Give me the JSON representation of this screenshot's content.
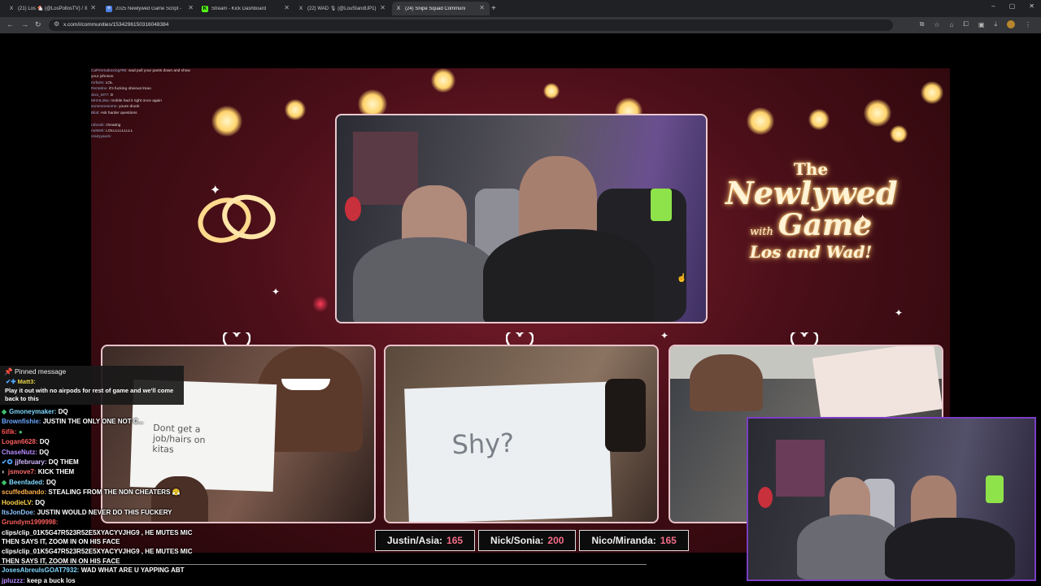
{
  "browser": {
    "tabs": [
      {
        "icon": "X",
        "title": "(21) Los 🐔 (@LosPollosTV) / X",
        "active": false
      },
      {
        "icon": "≡",
        "title": "2025 Newlywed Game Script -",
        "active": false
      },
      {
        "icon": "K",
        "title": "Stream - Kick Dashboard",
        "active": false
      },
      {
        "icon": "X",
        "title": "(22) WAD 🎙 (@LouStandUP1)",
        "active": false
      },
      {
        "icon": "X",
        "title": "(24) Snipe Squad Communi",
        "active": true
      }
    ],
    "new_tab": "+",
    "window_controls": [
      "–",
      "▢",
      "✕"
    ],
    "url": "x.com/i/communities/1534296150316048384",
    "icons": {
      "back": "←",
      "forward": "→",
      "reload": "↻",
      "tune": "⚙"
    }
  },
  "stream": {
    "title": {
      "line1": "The",
      "line2": "Newlywed",
      "with": "with",
      "game": "Game",
      "line3": "Los and Wad!"
    },
    "cards": {
      "card1": "Dont get a job/hairs on kitas",
      "card2": "Shy?"
    },
    "scores": [
      {
        "label": "Justin/Asia:",
        "value": "165"
      },
      {
        "label": "Nick/Sonia:",
        "value": "200"
      },
      {
        "label": "Nico/Miranda:",
        "value": "165"
      }
    ],
    "overlay_chat": [
      {
        "user": "CaPimmaboxing#98:",
        "text": "wad pull your pants down and show"
      },
      {
        "user": "",
        "text": "your johnson"
      },
      {
        "user": "mrfarts:",
        "text": "LOL"
      },
      {
        "user": "Rentafox:",
        "text": "it's fucking obvious lmao"
      },
      {
        "user": "Sixx_M77:",
        "text": "D"
      },
      {
        "user": "MrmrLdsa:",
        "text": "mobile had it right once again"
      },
      {
        "user": "someonesome:",
        "text": "youre drunk"
      },
      {
        "user": "Bilal:",
        "text": "Ask harder questions"
      },
      {
        "user": "",
        "text": ""
      },
      {
        "user": "robovki:",
        "text": "cheating"
      },
      {
        "user": "nuttsek:",
        "text": "LOLLLLLLLLLL"
      },
      {
        "user": "crazyyaxck:",
        "text": ""
      }
    ]
  },
  "pinned": {
    "header": "Pinned message",
    "user": "Matt3:",
    "message": "Play it out with no airpods for rest of game and we'll come back to this"
  },
  "chat": [
    {
      "user": "Gmoneymaker:",
      "color": "#7fd8ff",
      "text": "DQ"
    },
    {
      "user": "Brownfishie:",
      "color": "#6aa8ff",
      "text": "JUSTIN THE ONLY ONE NOT C..."
    },
    {
      "user": "6ifik:",
      "color": "#ff5252",
      "text": "●"
    },
    {
      "user": "Logan6628:",
      "color": "#ff5f5f",
      "text": "DQ"
    },
    {
      "user": "ChaseNutz:",
      "color": "#b88cff",
      "text": "DQ"
    },
    {
      "user": "jjfebruary:",
      "color": "#d2b8ff",
      "text": "DQ THEM"
    },
    {
      "user": "jsmove7:",
      "color": "#ff6a6a",
      "text": "KICK THEM"
    },
    {
      "user": "Beenfaded:",
      "color": "#7fd8ff",
      "text": "DQ"
    },
    {
      "user": "scuffedbando:",
      "color": "#ffb14a",
      "text": "STEALING FROM THE NON CHEATERS 😤"
    },
    {
      "user": "HoodieLV:",
      "color": "#ffd24a",
      "text": "DQ"
    },
    {
      "user": "ItsJonDoe:",
      "color": "#8fc6ff",
      "text": "JUSTIN WOULD NEVER DO THIS FUCKERY"
    },
    {
      "user": "Grundym1999998:",
      "color": "#ff5f5f",
      "text": ""
    },
    {
      "user": "",
      "color": "#fff",
      "text": "clips/clip_01K5G47R523R52E5XYACYVJHG9 , HE MUTES MIC"
    },
    {
      "user": "",
      "color": "#fff",
      "text": "THEN SAYS IT, ZOOM IN ON HIS FACE"
    },
    {
      "user": "",
      "color": "#fff",
      "text": "clips/clip_01K5G47R523R52E5XYACYVJHG9 , HE MUTES MIC"
    },
    {
      "user": "",
      "color": "#fff",
      "text": "THEN SAYS IT, ZOOM IN ON HIS FACE"
    },
    {
      "user": "JosesAbreuIsGOAT7932:",
      "color": "#7fd8ff",
      "text": "WAD WHAT ARE U YAPPING ABT"
    },
    {
      "user": "jpluzzz:",
      "color": "#b88cff",
      "text": "keep a buck los"
    }
  ],
  "colors": {
    "accent": "#f36c86",
    "webcam_border": "#7b3fc2",
    "stage": "#4b0f19"
  }
}
